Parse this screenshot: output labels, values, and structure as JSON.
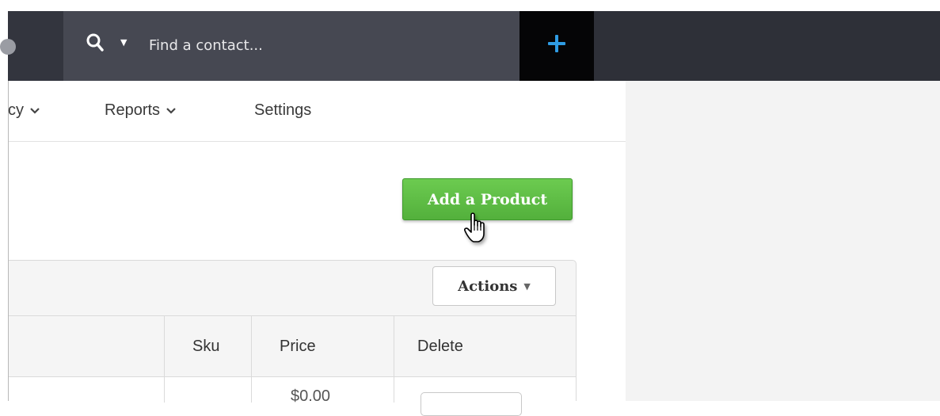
{
  "header": {
    "search": {
      "placeholder": "Find a contact...",
      "value": ""
    },
    "icons": {
      "search": "search-icon",
      "dropdown": "caret-down-icon",
      "add": "plus-icon"
    },
    "colors": {
      "bar": "#2e3038",
      "search_bg": "#464852",
      "plus": "#2f9ce3"
    }
  },
  "nav": {
    "items": [
      {
        "label": "cy",
        "has_dropdown": true
      },
      {
        "label": "Reports",
        "has_dropdown": true
      },
      {
        "label": "Settings",
        "has_dropdown": false
      }
    ]
  },
  "main": {
    "add_product_label": "Add a Product",
    "actions_label": "Actions",
    "table": {
      "columns": [
        "",
        "Sku",
        "Price",
        "Delete"
      ],
      "rows": [
        {
          "name": "",
          "sku": "",
          "price": "$0.00",
          "delete": ""
        }
      ]
    },
    "colors": {
      "add_button": "#5cbd45"
    }
  }
}
